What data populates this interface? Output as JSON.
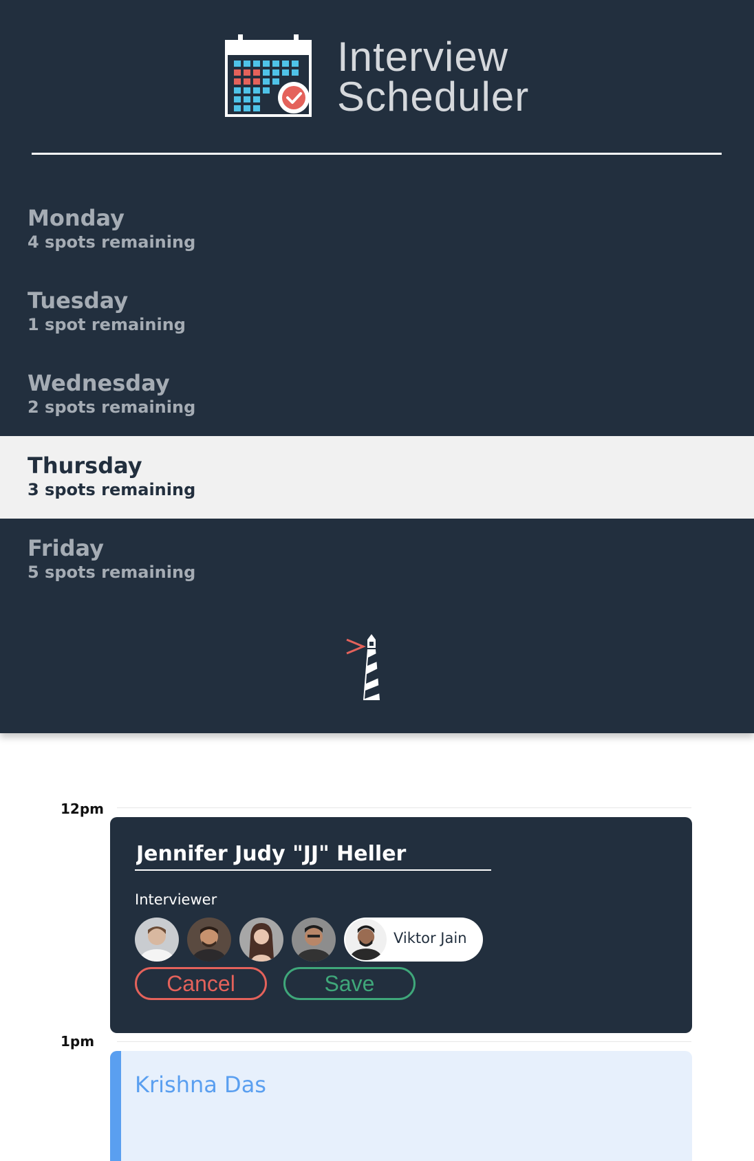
{
  "brand": {
    "title_line1": "Interview",
    "title_line2": "Scheduler",
    "logo_icon": "calendar-check-icon"
  },
  "days": [
    {
      "name": "Monday",
      "spots": "4 spots remaining",
      "selected": false
    },
    {
      "name": "Tuesday",
      "spots": "1 spot remaining",
      "selected": false
    },
    {
      "name": "Wednesday",
      "spots": "2 spots remaining",
      "selected": false
    },
    {
      "name": "Thursday",
      "spots": "3 spots remaining",
      "selected": true
    },
    {
      "name": "Friday",
      "spots": "5 spots remaining",
      "selected": false
    }
  ],
  "footer_logo_icon": "lighthouse-icon",
  "schedule": {
    "slots": [
      {
        "time": "12pm"
      },
      {
        "time": "1pm"
      }
    ],
    "form": {
      "student_name": "Jennifer Judy \"JJ\" Heller",
      "interviewer_label": "Interviewer",
      "selected_interviewer": "Viktor Jain",
      "cancel_label": "Cancel",
      "save_label": "Save"
    },
    "appointment": {
      "student": "Krishna Das"
    }
  },
  "colors": {
    "sidebar_bg": "#222f3e",
    "selected_day_bg": "#f1f1f1",
    "cancel": "#e4625b",
    "save": "#3fa77a",
    "appointment_accent": "#5a9ff0",
    "appointment_bg": "#e7f0fc"
  }
}
